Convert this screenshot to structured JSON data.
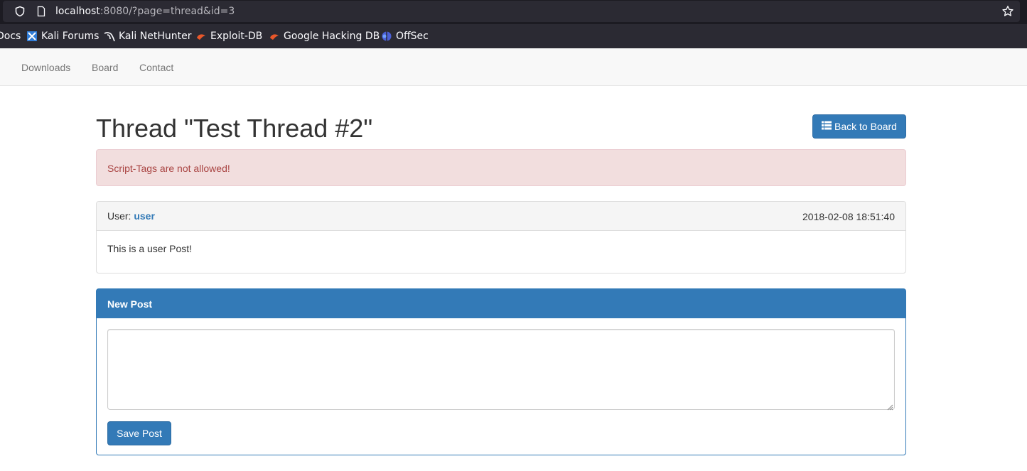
{
  "browser": {
    "url_host": "localhost",
    "url_rest": ":8080/?page=thread&id=3",
    "bookmarks": [
      {
        "label": "Docs",
        "icon": "kali-docs-icon"
      },
      {
        "label": "Kali Forums",
        "icon": "kali-forums-icon"
      },
      {
        "label": "Kali NetHunter",
        "icon": "kali-nethunter-icon"
      },
      {
        "label": "Exploit-DB",
        "icon": "exploit-db-icon"
      },
      {
        "label": "Google Hacking DB",
        "icon": "google-hacking-db-icon"
      },
      {
        "label": "OffSec",
        "icon": "offsec-icon"
      }
    ]
  },
  "navbar": {
    "links": [
      "Downloads",
      "Board",
      "Contact"
    ]
  },
  "page": {
    "title": "Thread \"Test Thread #2\"",
    "back_button": "Back to Board",
    "alert": "Script-Tags are not allowed!"
  },
  "post": {
    "user_label": "User:",
    "username": "user",
    "date": "2018-02-08 18:51:40",
    "body": "This is a user Post!"
  },
  "new_post": {
    "heading": "New Post",
    "textarea_value": "",
    "save_button": "Save Post"
  },
  "colors": {
    "primary": "#337ab7",
    "alert_bg": "#f2dede",
    "alert_text": "#a94442"
  }
}
